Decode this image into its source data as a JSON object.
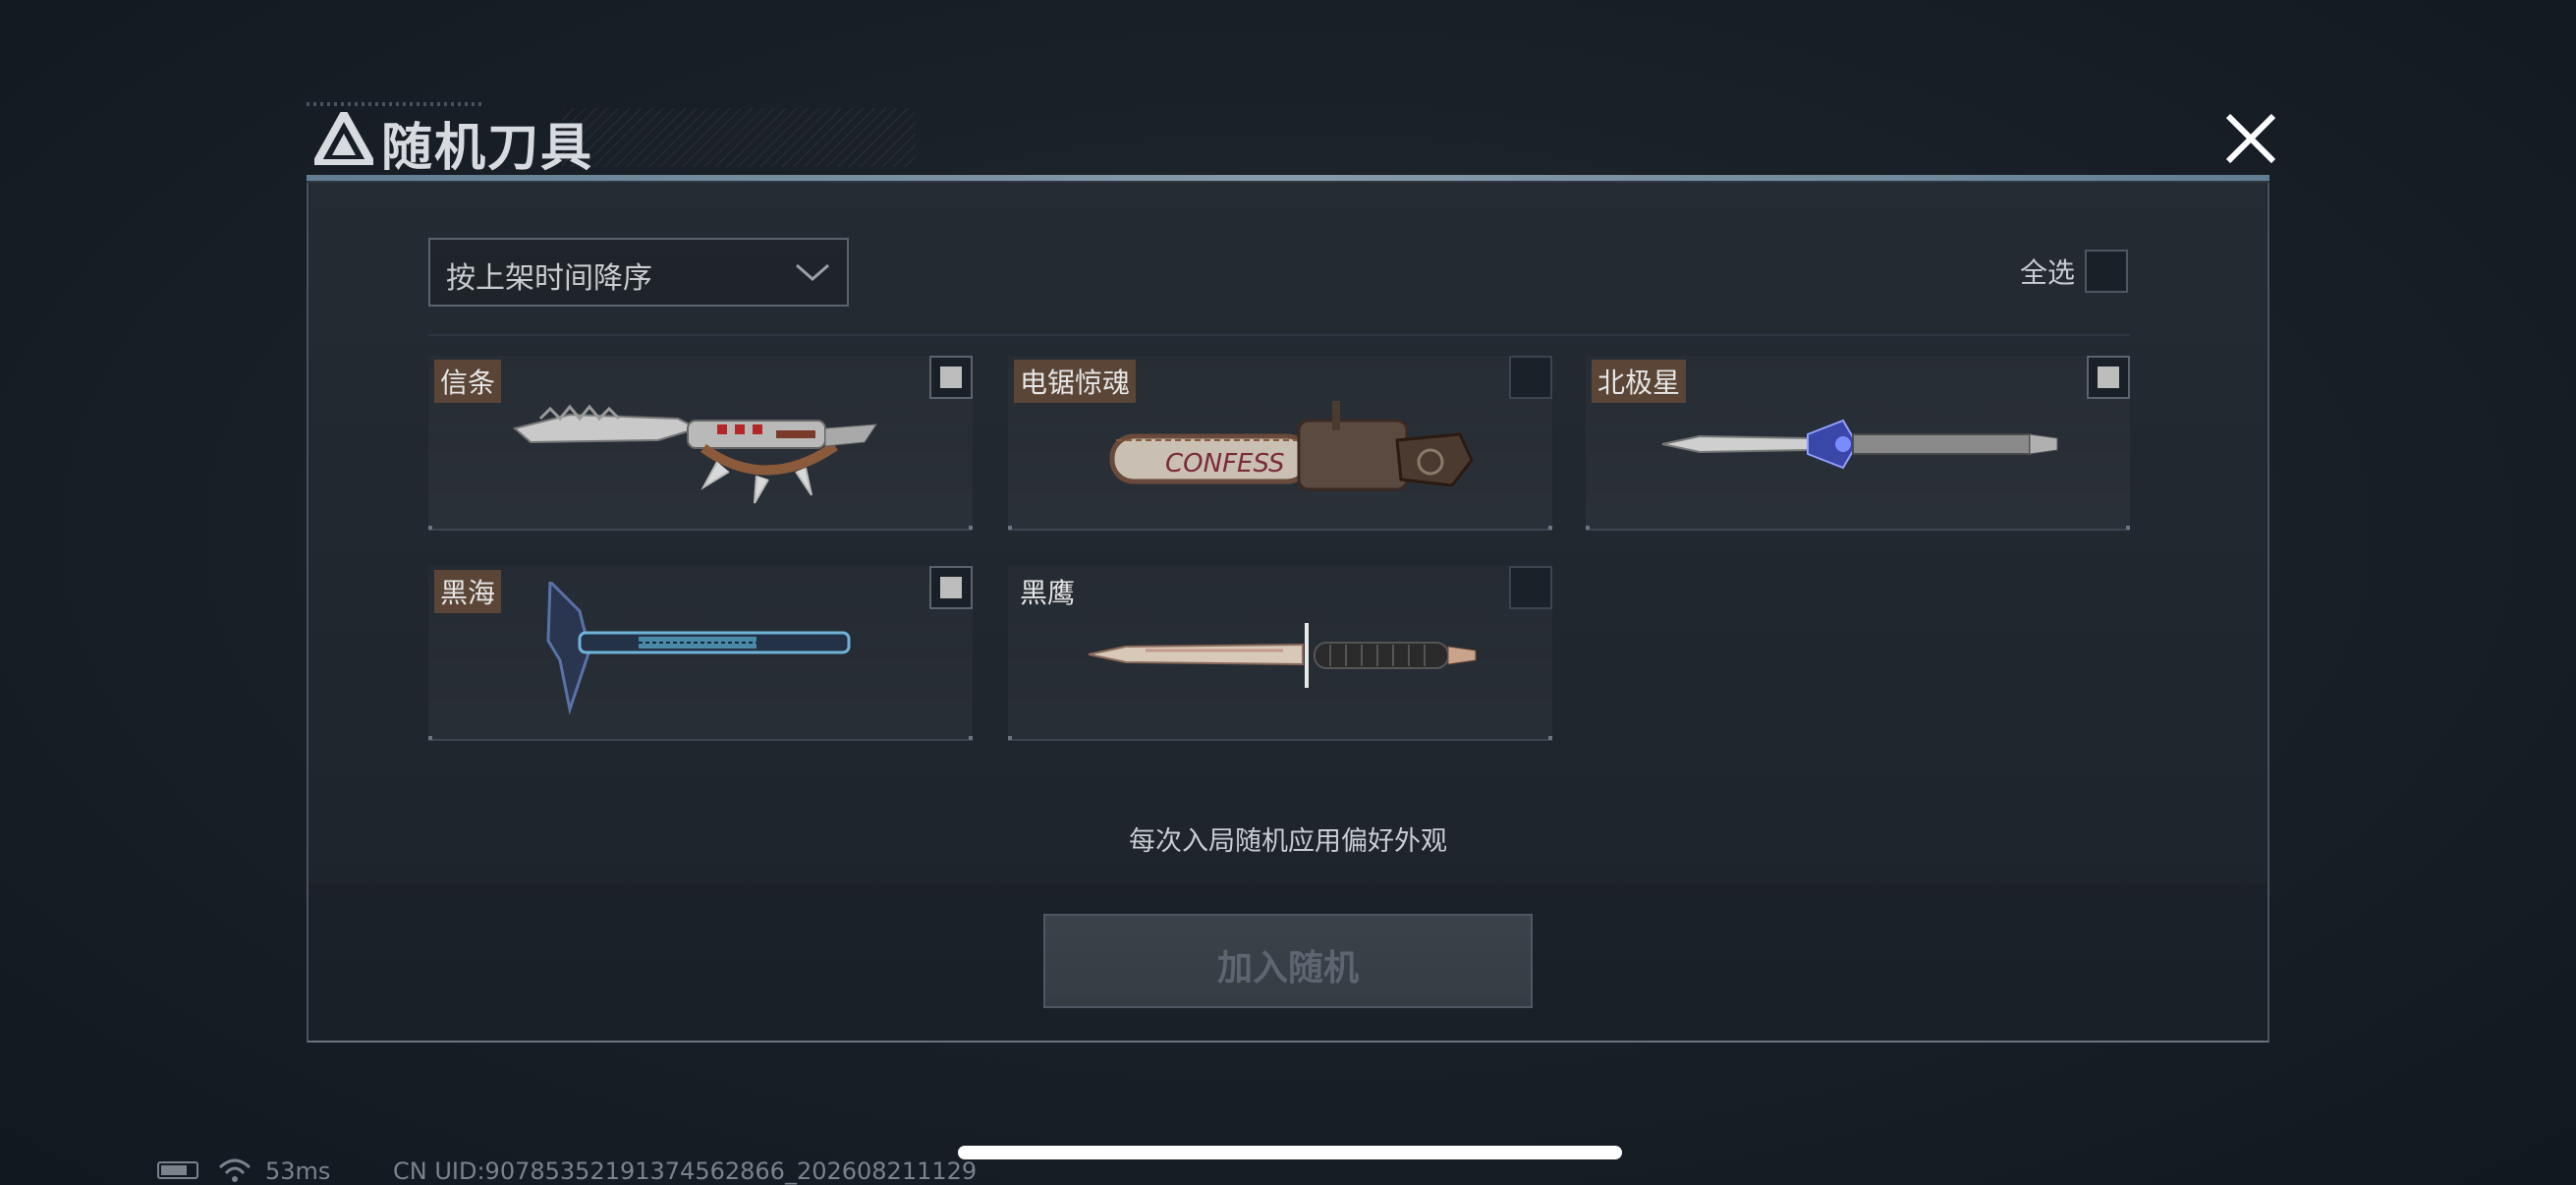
{
  "header": {
    "title": "随机刀具"
  },
  "toolbar": {
    "sort_value": "按上架时间降序",
    "select_all_label": "全选"
  },
  "items": [
    {
      "name": "信条",
      "checked": true
    },
    {
      "name": "电锯惊魂",
      "checked": false
    },
    {
      "name": "北极星",
      "checked": true
    },
    {
      "name": "黑海",
      "checked": true
    },
    {
      "name": "黑鹰",
      "checked": false
    }
  ],
  "hint": "每次入局随机应用偏好外观",
  "join_button": {
    "label": "加入随机",
    "enabled": false
  },
  "status_bar": {
    "ping": "53ms",
    "uid": "CN UID:907853521913745628​66_202608211129"
  }
}
